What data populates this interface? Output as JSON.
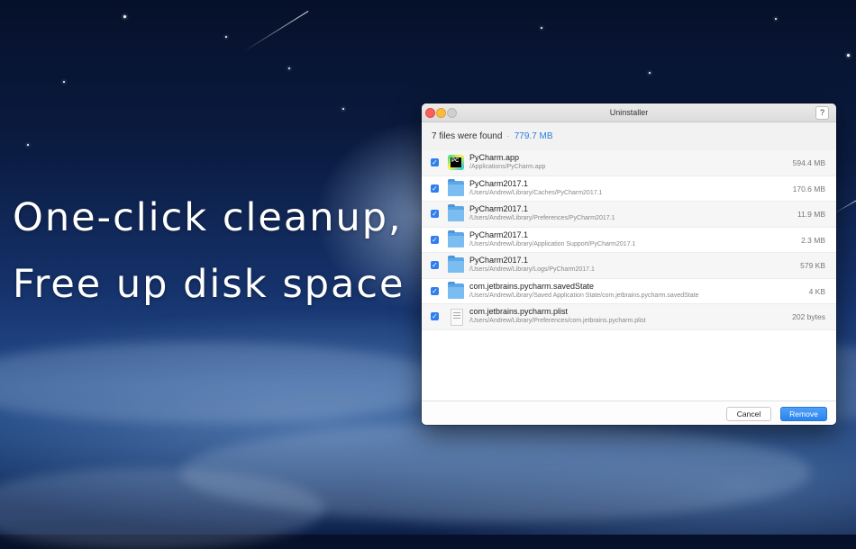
{
  "headline": {
    "line1": "One-click cleanup,",
    "line2": "Free up disk space"
  },
  "window": {
    "title": "Uninstaller",
    "help_label": "?",
    "summary": {
      "found_text": "7 files were found",
      "separator": "·",
      "total_size": "779.7 MB"
    },
    "files": [
      {
        "name": "PyCharm.app",
        "path": "/Applications/PyCharm.app",
        "size": "594.4 MB",
        "icon": "pycharm-app-icon",
        "checked": true
      },
      {
        "name": "PyCharm2017.1",
        "path": "/Users/Andrew/Library/Caches/PyCharm2017.1",
        "size": "170.6 MB",
        "icon": "folder-icon",
        "checked": true
      },
      {
        "name": "PyCharm2017.1",
        "path": "/Users/Andrew/Library/Preferences/PyCharm2017.1",
        "size": "11.9 MB",
        "icon": "folder-icon",
        "checked": true
      },
      {
        "name": "PyCharm2017.1",
        "path": "/Users/Andrew/Library/Application Support/PyCharm2017.1",
        "size": "2.3 MB",
        "icon": "folder-icon",
        "checked": true
      },
      {
        "name": "PyCharm2017.1",
        "path": "/Users/Andrew/Library/Logs/PyCharm2017.1",
        "size": "579 KB",
        "icon": "folder-icon",
        "checked": true
      },
      {
        "name": "com.jetbrains.pycharm.savedState",
        "path": "/Users/Andrew/Library/Saved Application State/com.jetbrains.pycharm.savedState",
        "size": "4 KB",
        "icon": "folder-icon",
        "checked": true
      },
      {
        "name": "com.jetbrains.pycharm.plist",
        "path": "/Users/Andrew/Library/Preferences/com.jetbrains.pycharm.plist",
        "size": "202 bytes",
        "icon": "plist-file-icon",
        "checked": true
      }
    ],
    "buttons": {
      "cancel": "Cancel",
      "remove": "Remove"
    }
  },
  "app_icon_text": "PC",
  "colors": {
    "accent": "#2b7de0",
    "checkbox": "#2f7ef0",
    "folder": "#5ba7e8"
  }
}
